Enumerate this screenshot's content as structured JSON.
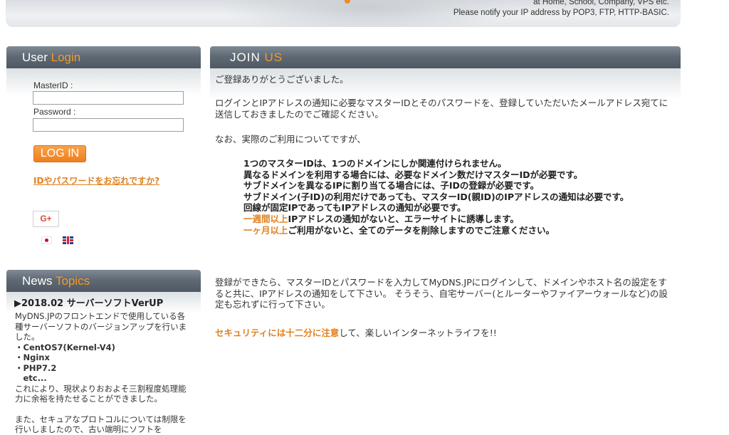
{
  "banner": {
    "line1": "at Home, School, Company, VPS etc.",
    "line2": "Please notify your IP address by POP3, FTP, HTTP-BASIC."
  },
  "login": {
    "heading_main": "User ",
    "heading_accent": "Login",
    "masterid_label": "MasterID :",
    "password_label": "Password :",
    "masterid_value": "",
    "password_value": "",
    "login_button": "LOG IN",
    "forgot_link": "IDやパスワードをお忘れですか?",
    "gplus_label": "G+"
  },
  "news": {
    "heading_main": "News ",
    "heading_accent": "Topics",
    "title": "▶2018.02 サーバーソフトVerUP",
    "intro": "MyDNS.JPのフロントエンドで使用している各種サーバーソフトのバージョンアップを行いました。",
    "items": [
      "・CentOS7(Kernel-V4)",
      "・Nginx",
      "・PHP7.2",
      "　etc..."
    ],
    "result": "これにより、現状よりおおよそ三割程度処理能力に余裕を持たせることができました。",
    "more": "また、セキュアなプロトコルについては制限を行いしましたので、古い端明にソフトを"
  },
  "join": {
    "heading_main": "JOIN ",
    "heading_accent": "US",
    "thanks": "ご登録ありがとうございました。",
    "mail_note": "ログインとIPアドレスの通知に必要なマスターIDとそのパスワードを、登録していただいたメールアドレス宛てに送信しておきましたのでご確認ください。",
    "usage_note": "なお、実際のご利用についてですが、",
    "rules": {
      "r1": "1つのマスターIDは、1つのドメインにしか関連付けられません。",
      "r2": "異なるドメインを利用する場合には、必要なドメイン数だけマスターIDが必要です。",
      "r3": "サブドメインを異なるIPに割り当てる場合には、子IDの登録が必要です。",
      "r4": "サブドメイン(子ID)の利用だけであっても、マスターID(親ID)のIPアドレスの通知は必要です。",
      "r5": "回線が固定IPであってもIPアドレスの通知が必要です。",
      "r6_accent": "一週間以上",
      "r6_rest": "IPアドレスの通知がないと、エラーサイトに誘導します。",
      "r7_accent": "一ヶ月以上",
      "r7_rest": "ご利用がないと、全てのデータを削除しますのでご注意ください。"
    },
    "after_reg": "登録ができたら、マスターIDとパスワードを入力してMyDNS.JPにログインして、ドメインやホスト名の設定をすると共に、IPアドレスの通知をして下さい。 そうそう、自宅サーバー(とルーターやファイアーウォールなど)の設定も忘れずに行って下さい。",
    "security_accent": "セキュリティには十二分に注意",
    "security_rest": "して、楽しいインターネットライフを!!"
  },
  "colors": {
    "accent": "#e0801e",
    "bar": "#5f6a74"
  }
}
